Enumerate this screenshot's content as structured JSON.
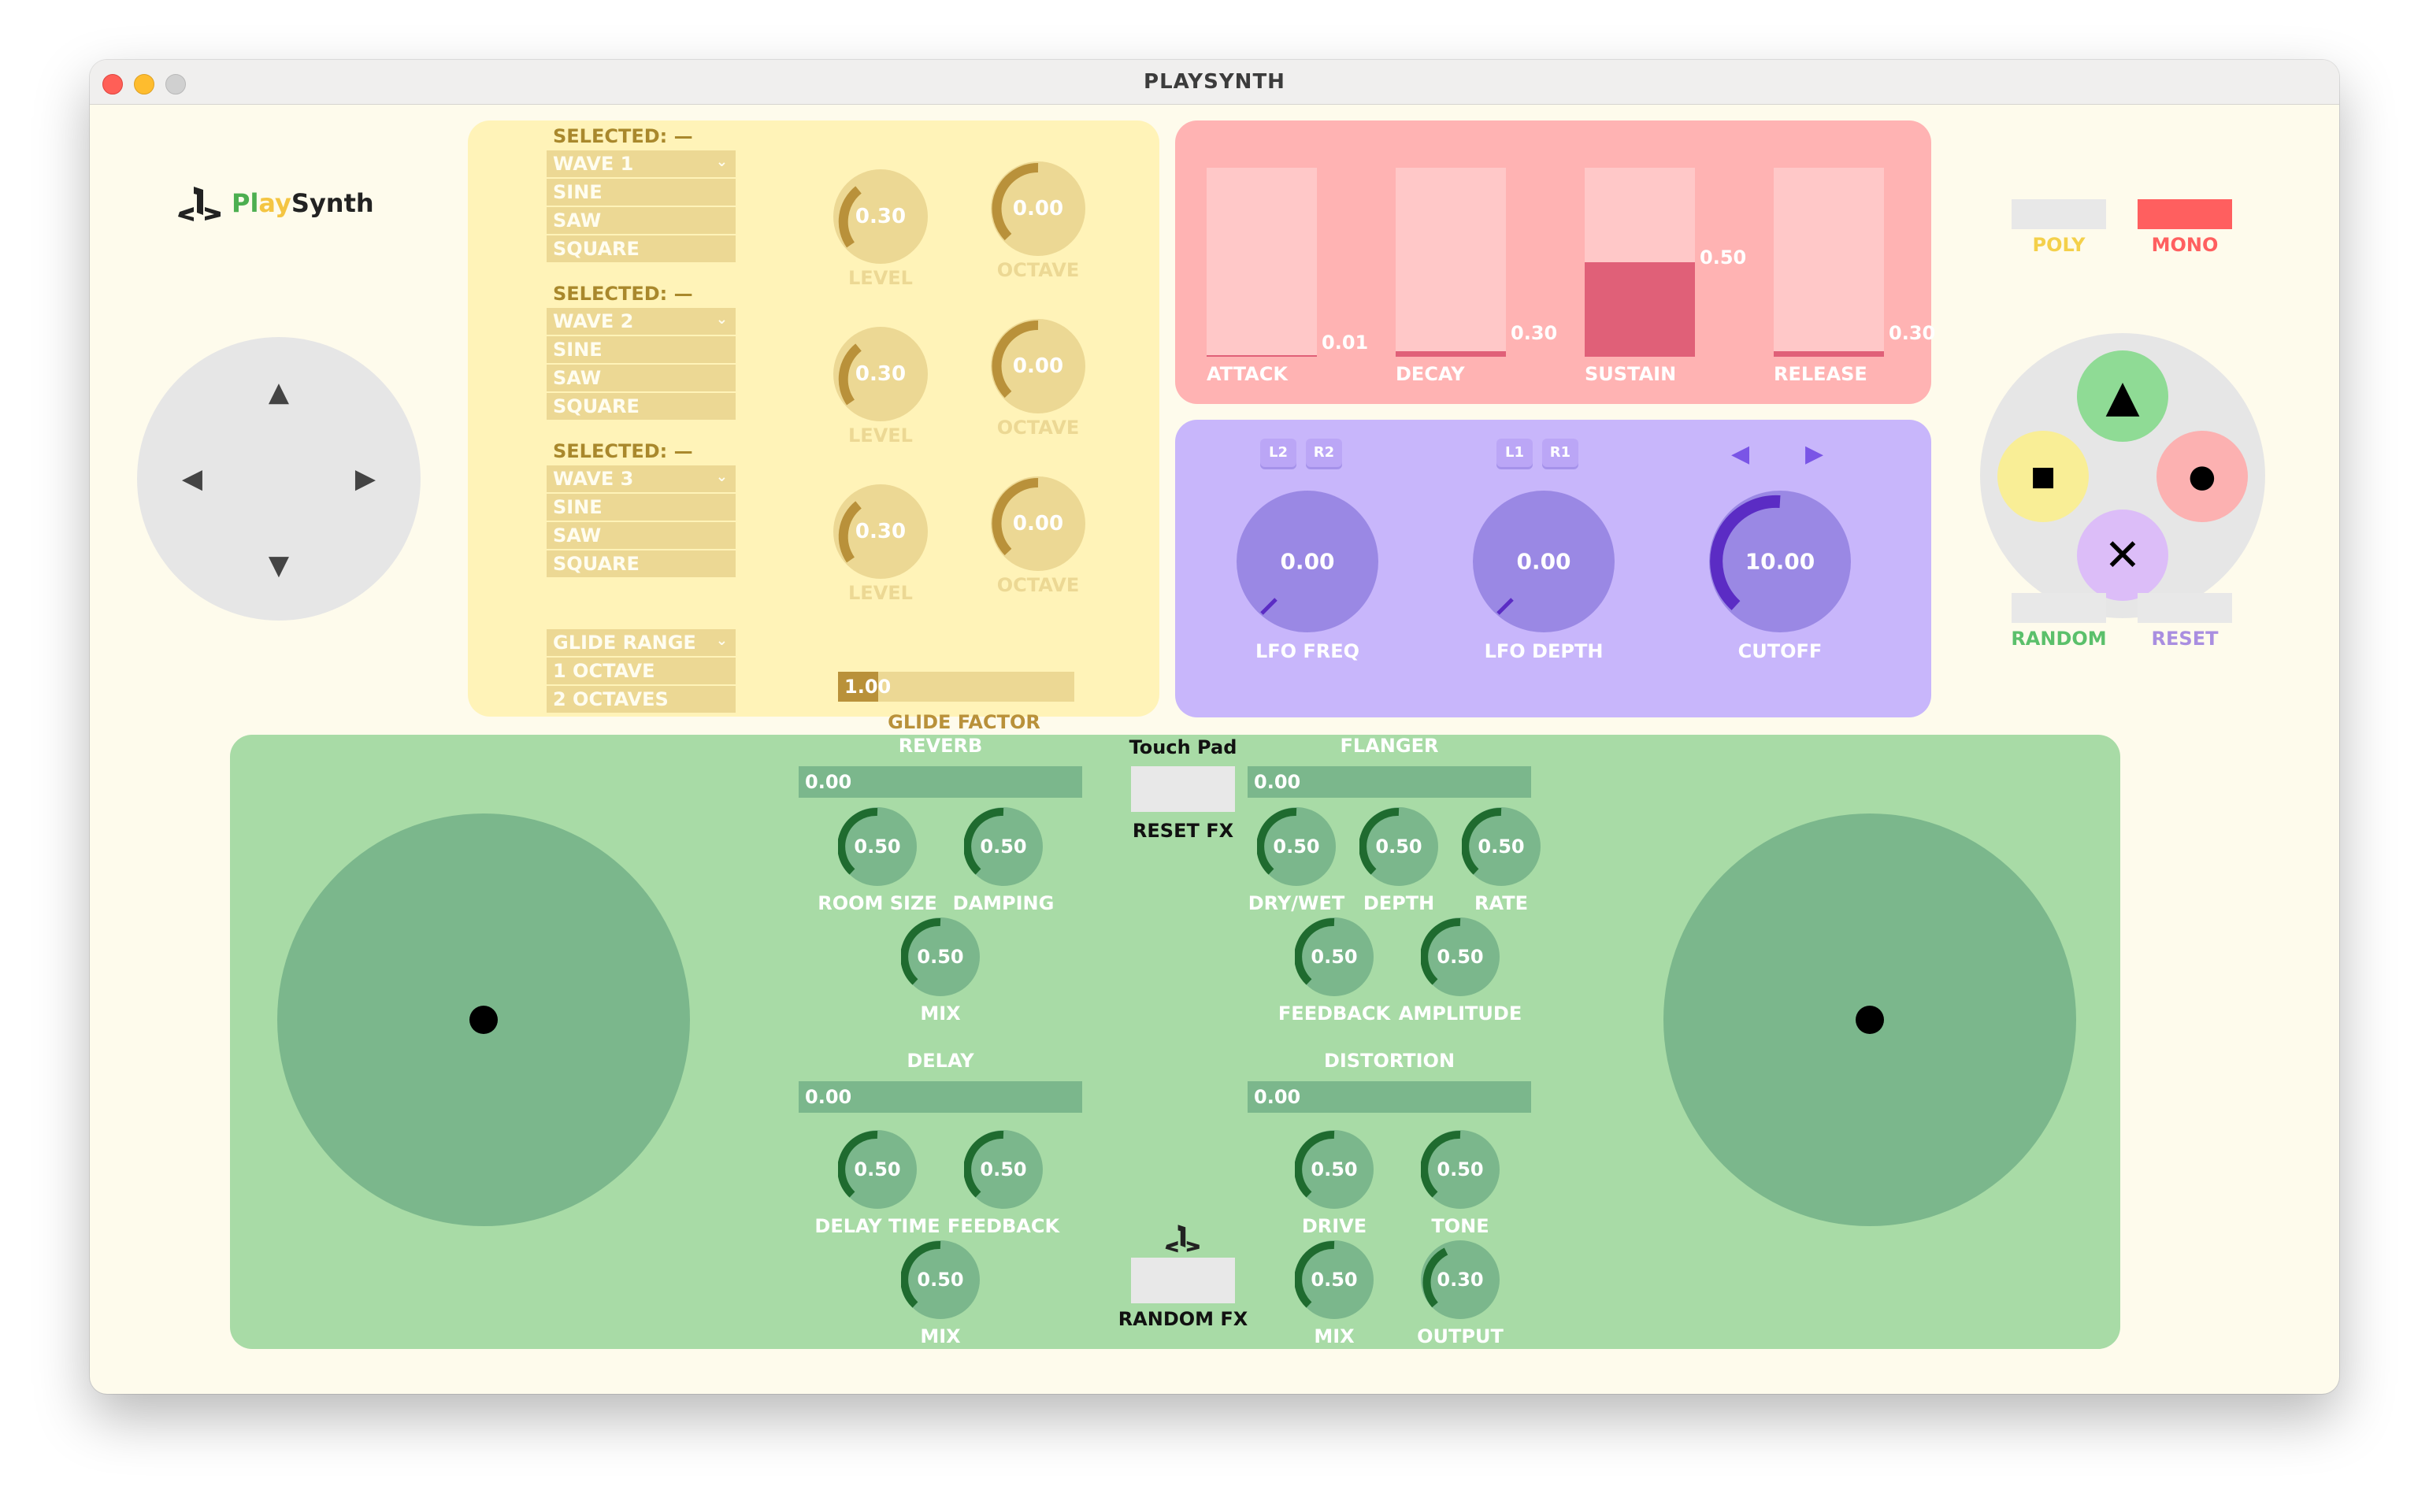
{
  "window": {
    "title": "PLAYSYNTH"
  },
  "logo": {
    "text_pl": "Pl",
    "text_ay": "ay",
    "text_synth": "Synth"
  },
  "colors": {
    "osc_panel": "#fff3b8",
    "env_panel": "#ffb3b3",
    "lfo_panel": "#c8b6fb",
    "fx_panel": "#a8dba6",
    "mono_active": "#ff5f5f"
  },
  "dpad": {
    "up": "▲",
    "down": "▼",
    "left": "◀",
    "right": "▶"
  },
  "oscillators": [
    {
      "selected": "SELECTED: —",
      "header": "WAVE 1",
      "options": [
        "SINE",
        "SAW",
        "SQUARE"
      ],
      "level": "0.30",
      "level_label": "LEVEL",
      "octave": "0.00",
      "octave_label": "OCTAVE"
    },
    {
      "selected": "SELECTED: —",
      "header": "WAVE 2",
      "options": [
        "SINE",
        "SAW",
        "SQUARE"
      ],
      "level": "0.30",
      "level_label": "LEVEL",
      "octave": "0.00",
      "octave_label": "OCTAVE"
    },
    {
      "selected": "SELECTED: —",
      "header": "WAVE 3",
      "options": [
        "SINE",
        "SAW",
        "SQUARE"
      ],
      "level": "0.30",
      "level_label": "LEVEL",
      "octave": "0.00",
      "octave_label": "OCTAVE"
    }
  ],
  "glide": {
    "header": "GLIDE RANGE",
    "options": [
      "1 OCTAVE",
      "2 OCTAVES"
    ],
    "factor_value": "1.00",
    "factor_label": "GLIDE FACTOR",
    "factor_fraction": 0.17
  },
  "envelope": [
    {
      "label": "ATTACK",
      "value": "0.01",
      "level": 0.01
    },
    {
      "label": "DECAY",
      "value": "0.30",
      "level": 0.03
    },
    {
      "label": "SUSTAIN",
      "value": "0.50",
      "level": 0.5
    },
    {
      "label": "RELEASE",
      "value": "0.30",
      "level": 0.03
    }
  ],
  "lfo": {
    "freq": {
      "value": "0.00",
      "label": "LFO FREQ",
      "shoulders": [
        "L2",
        "R2"
      ]
    },
    "depth": {
      "value": "0.00",
      "label": "LFO DEPTH",
      "shoulders": [
        "L1",
        "R1"
      ]
    },
    "cutoff": {
      "value": "10.00",
      "label": "CUTOFF",
      "arrow_left": "◀",
      "arrow_right": "▶"
    }
  },
  "modes": {
    "poly": "POLY",
    "mono": "MONO",
    "random": "RANDOM",
    "reset": "RESET"
  },
  "face_buttons": {
    "triangle": "▲",
    "square": "■",
    "circle": "●",
    "cross": "✕"
  },
  "fx": {
    "reverb": {
      "title": "REVERB",
      "value": "0.00",
      "knobs": [
        {
          "value": "0.50",
          "label": "ROOM SIZE"
        },
        {
          "value": "0.50",
          "label": "DAMPING"
        },
        {
          "value": "0.50",
          "label": "MIX"
        }
      ]
    },
    "flanger": {
      "title": "FLANGER",
      "value": "0.00",
      "knobs": [
        {
          "value": "0.50",
          "label": "DRY/WET"
        },
        {
          "value": "0.50",
          "label": "DEPTH"
        },
        {
          "value": "0.50",
          "label": "RATE"
        },
        {
          "value": "0.50",
          "label": "FEEDBACK"
        },
        {
          "value": "0.50",
          "label": "AMPLITUDE"
        }
      ]
    },
    "delay": {
      "title": "DELAY",
      "value": "0.00",
      "knobs": [
        {
          "value": "0.50",
          "label": "DELAY TIME"
        },
        {
          "value": "0.50",
          "label": "FEEDBACK"
        },
        {
          "value": "0.50",
          "label": "MIX"
        }
      ]
    },
    "distortion": {
      "title": "DISTORTION",
      "value": "0.00",
      "knobs": [
        {
          "value": "0.50",
          "label": "DRIVE"
        },
        {
          "value": "0.50",
          "label": "TONE"
        },
        {
          "value": "0.50",
          "label": "MIX"
        },
        {
          "value": "0.30",
          "label": "OUTPUT"
        }
      ]
    },
    "touch_pad_label": "Touch Pad",
    "reset_fx": "RESET FX",
    "random_fx": "RANDOM FX"
  }
}
